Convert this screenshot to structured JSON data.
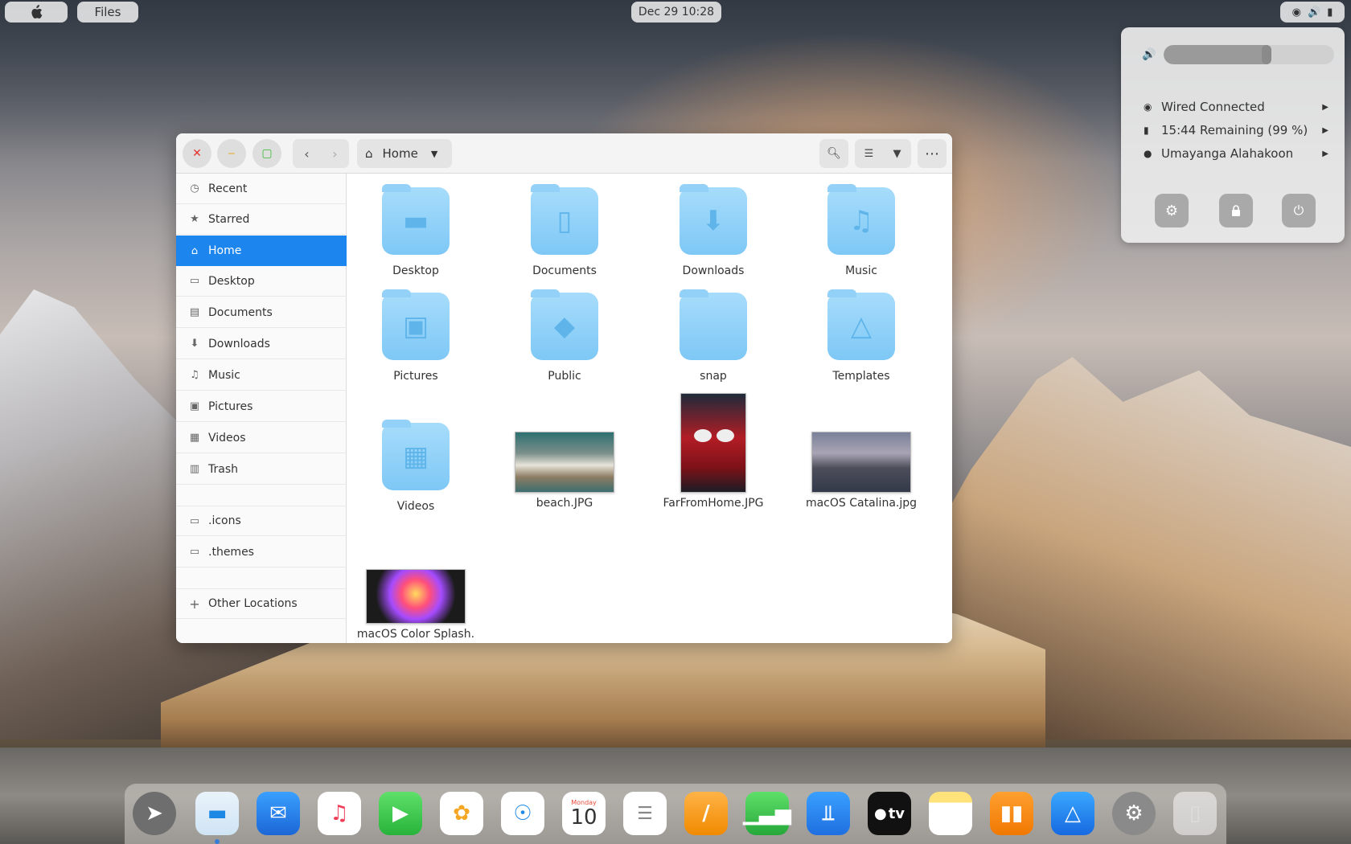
{
  "topbar": {
    "apple_icon": "apple-logo",
    "app_name": "Files",
    "clock": "Dec 29  10:28",
    "tray_icons": [
      "network-icon",
      "volume-icon",
      "battery-icon"
    ]
  },
  "system_menu": {
    "volume_level": 0.6,
    "rows": [
      {
        "icon": "network-icon",
        "label": "Wired Connected"
      },
      {
        "icon": "battery-icon",
        "label": "15:44 Remaining (99 %)"
      },
      {
        "icon": "user-icon",
        "label": "Umayanga Alahakoon"
      }
    ],
    "buttons": [
      "settings-icon",
      "lock-icon",
      "power-icon"
    ]
  },
  "window": {
    "path_label": "Home",
    "sidebar": {
      "places": [
        "Recent",
        "Starred",
        "Home",
        "Desktop",
        "Documents",
        "Downloads",
        "Music",
        "Pictures",
        "Videos",
        "Trash"
      ],
      "bookmarks": [
        ".icons",
        ".themes"
      ],
      "other": "Other Locations",
      "active": "Home"
    },
    "items": [
      {
        "name": "Desktop",
        "kind": "folder"
      },
      {
        "name": "Documents",
        "kind": "folder"
      },
      {
        "name": "Downloads",
        "kind": "folder"
      },
      {
        "name": "Music",
        "kind": "folder"
      },
      {
        "name": "Pictures",
        "kind": "folder"
      },
      {
        "name": "Public",
        "kind": "folder"
      },
      {
        "name": "snap",
        "kind": "folder"
      },
      {
        "name": "Templates",
        "kind": "folder"
      },
      {
        "name": "Videos",
        "kind": "folder"
      },
      {
        "name": "beach.JPG",
        "kind": "image"
      },
      {
        "name": "FarFromHome.JPG",
        "kind": "image"
      },
      {
        "name": "macOS Catalina.jpg",
        "kind": "image"
      },
      {
        "name": "macOS Color Splash.",
        "kind": "image"
      }
    ]
  },
  "dock": {
    "calendar_day": "Monday",
    "calendar_date": "10",
    "tv_label": "tv",
    "apps": [
      "Launchpad",
      "Files",
      "Mail",
      "Music",
      "FaceTime",
      "Photos",
      "Safari",
      "Calendar",
      "Reminders",
      "Pages",
      "Numbers",
      "Keynote",
      "Apple TV",
      "Notes",
      "Books",
      "App Store",
      "System Preferences",
      "Trash"
    ]
  }
}
